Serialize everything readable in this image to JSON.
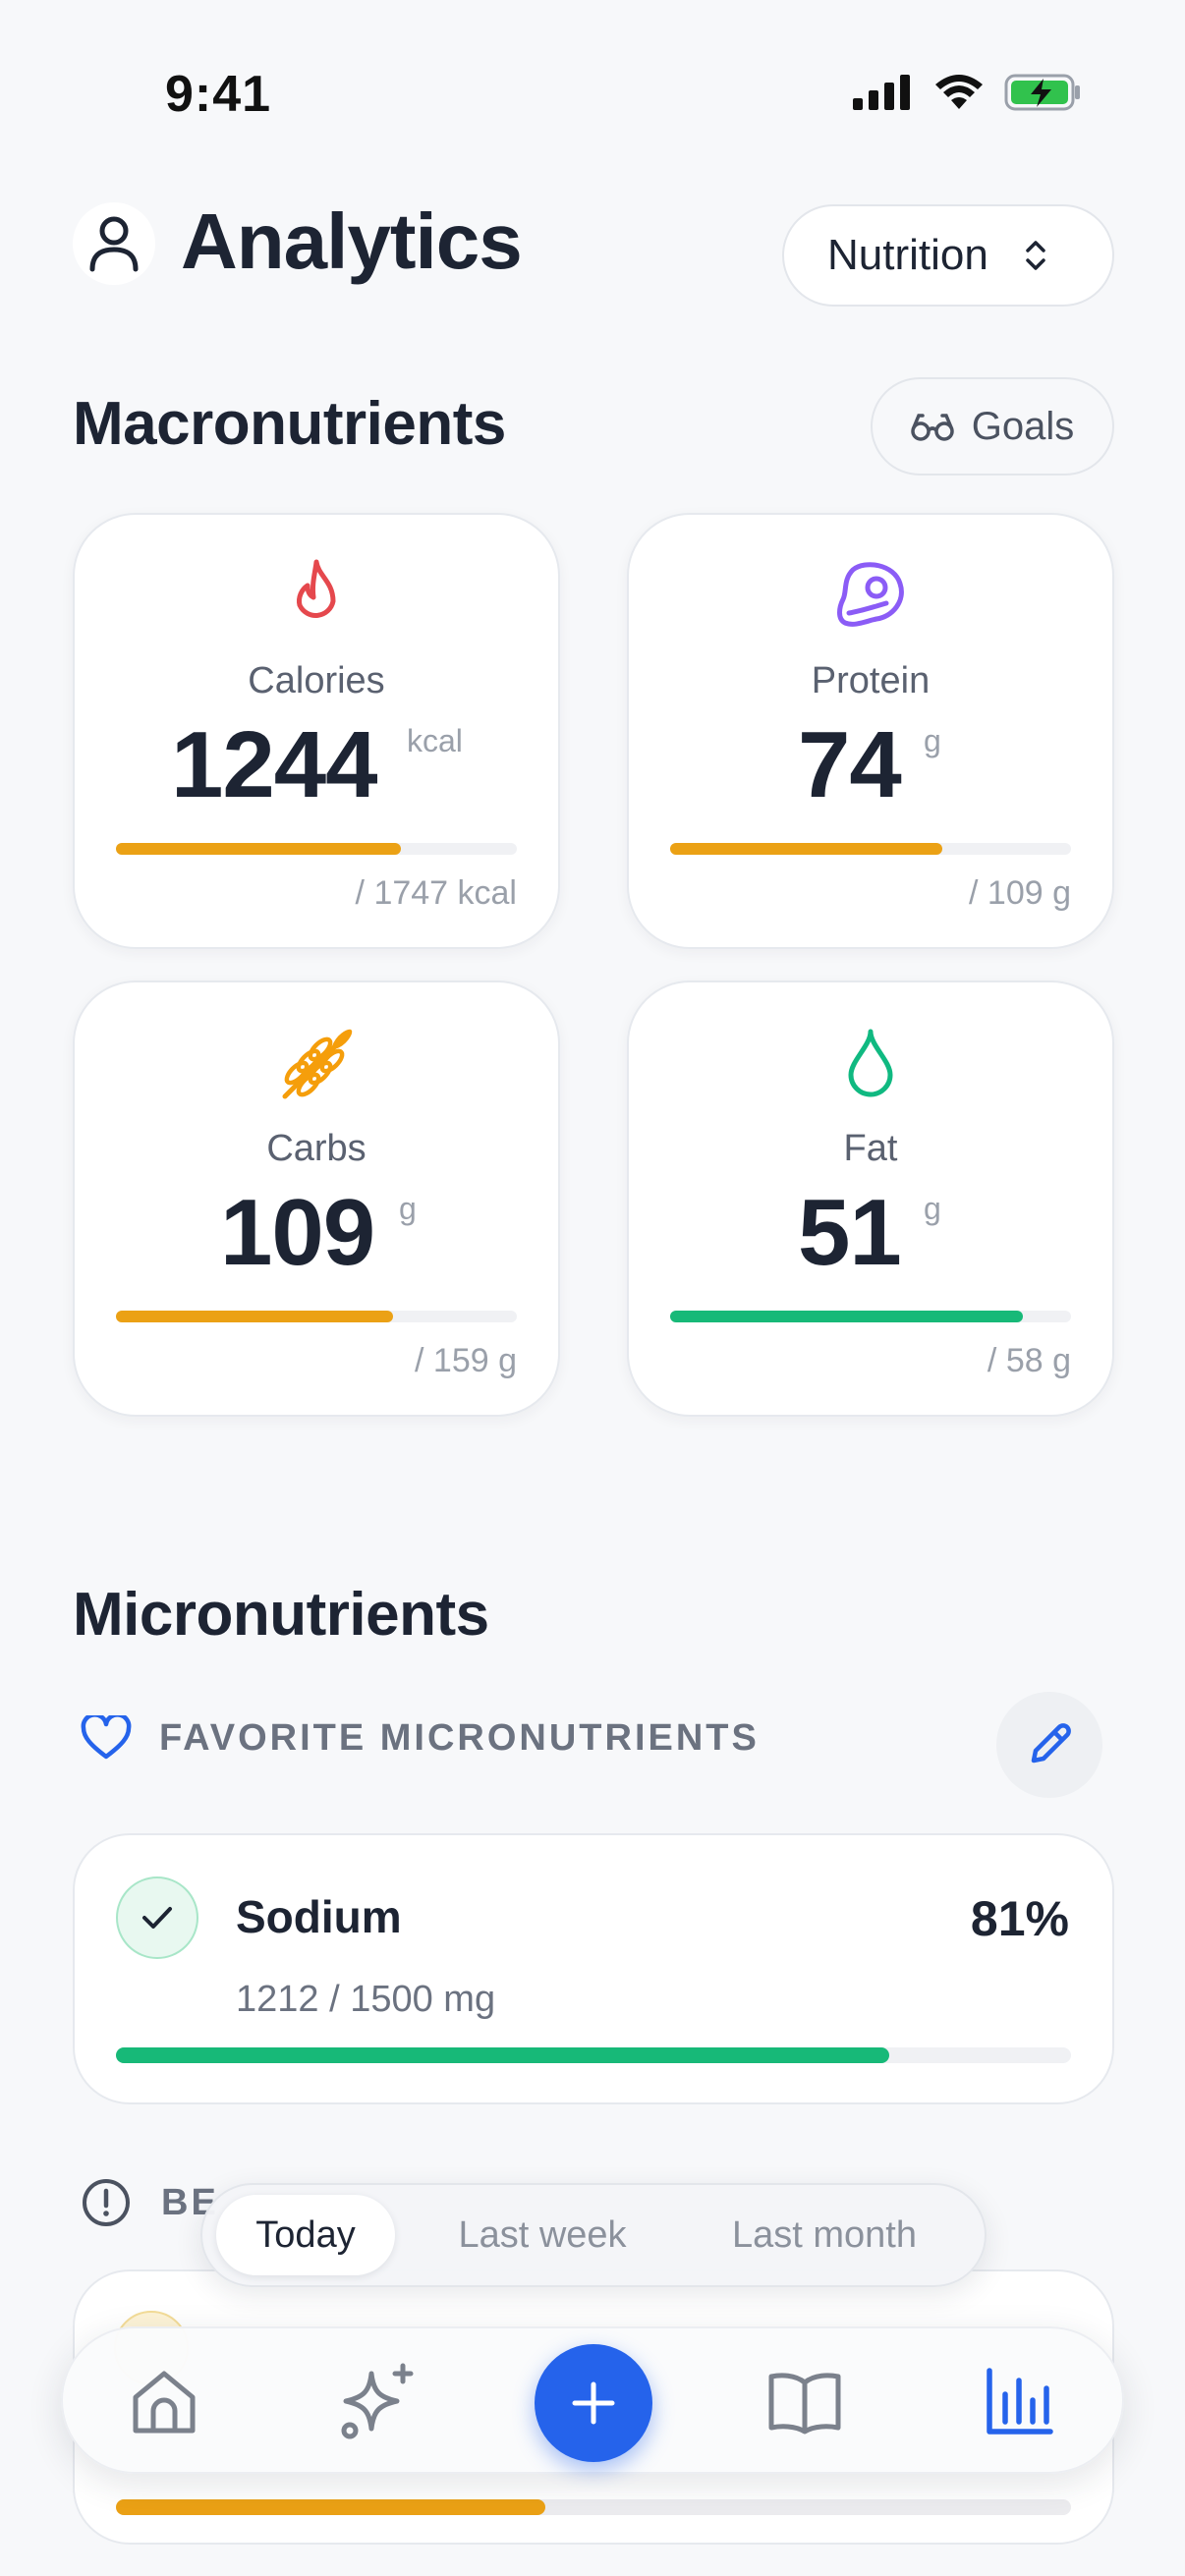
{
  "status_bar": {
    "time": "9:41"
  },
  "header": {
    "title": "Analytics",
    "selector_label": "Nutrition"
  },
  "macros": {
    "title": "Macronutrients",
    "goals_label": "Goals",
    "cards": [
      {
        "name": "Calories",
        "value": "1244",
        "unit": "kcal",
        "target": "/ 1747 kcal",
        "progress": 0.71,
        "color": "#eba115",
        "icon": "flame-icon",
        "icon_color": "#e5484d"
      },
      {
        "name": "Protein",
        "value": "74",
        "unit": "g",
        "target": "/ 109 g",
        "progress": 0.68,
        "color": "#eba115",
        "icon": "steak-icon",
        "icon_color": "#8b5cf6"
      },
      {
        "name": "Carbs",
        "value": "109",
        "unit": "g",
        "target": "/ 159 g",
        "progress": 0.69,
        "color": "#eba115",
        "icon": "wheat-icon",
        "icon_color": "#f59e0b"
      },
      {
        "name": "Fat",
        "value": "51",
        "unit": "g",
        "target": "/ 58 g",
        "progress": 0.88,
        "color": "#17b978",
        "icon": "droplet-icon",
        "icon_color": "#10b981"
      }
    ]
  },
  "micros": {
    "title": "Micronutrients",
    "favorites_label": "FAVORITE MICRONUTRIENTS",
    "favorite_items": [
      {
        "name": "Sodium",
        "percent": "81%",
        "amount": "1212 / 1500 mg",
        "progress": 0.81,
        "color": "#17b978"
      }
    ],
    "second_section_label_visible": "BE",
    "hidden_item_progress": 0.45,
    "hidden_item_color": "#eba115"
  },
  "period": {
    "options": [
      "Today",
      "Last week",
      "Last month"
    ],
    "selected": "Today"
  },
  "tabbar": {
    "items": [
      "home-icon",
      "sparkles-icon",
      "add-button",
      "book-icon",
      "chart-icon"
    ],
    "active": "chart-icon",
    "accent": "#2563eb"
  }
}
